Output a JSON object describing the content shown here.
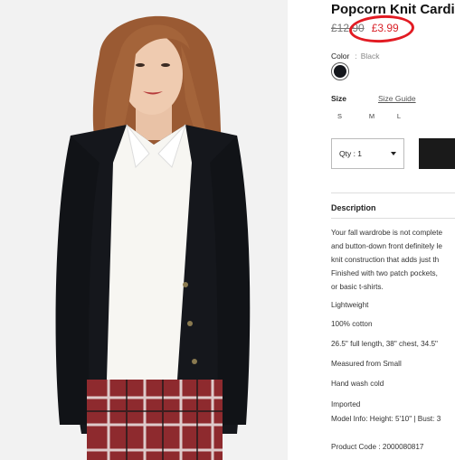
{
  "product": {
    "title": "Popcorn Knit Cardig",
    "old_price": "£12.90",
    "new_price": "£3.99",
    "color_label": "Color",
    "color_sep": ":",
    "color_value": "Black",
    "swatch_color": "#14161c",
    "size_label": "Size",
    "size_guide": "Size Guide",
    "sizes": [
      "S",
      "M",
      "L"
    ],
    "qty_label": "Qty : 1",
    "description_title": "Description",
    "description_lines": [
      "Your fall wardrobe is not complete",
      "and button-down front definitely le",
      "knit construction that adds just th",
      "Finished with two patch pockets,",
      "or basic t-shirts."
    ],
    "specs": [
      "Lightweight",
      "100% cotton",
      "26.5\" full length, 38\" chest, 34.5\"",
      "Measured from Small",
      "Hand wash cold",
      "Imported",
      "Model Info: Height: 5'10\" | Bust: 3",
      "Product Code : 2000080817"
    ]
  },
  "colors": {
    "accent_red": "#d9232a",
    "circle_red": "#e21b23"
  }
}
